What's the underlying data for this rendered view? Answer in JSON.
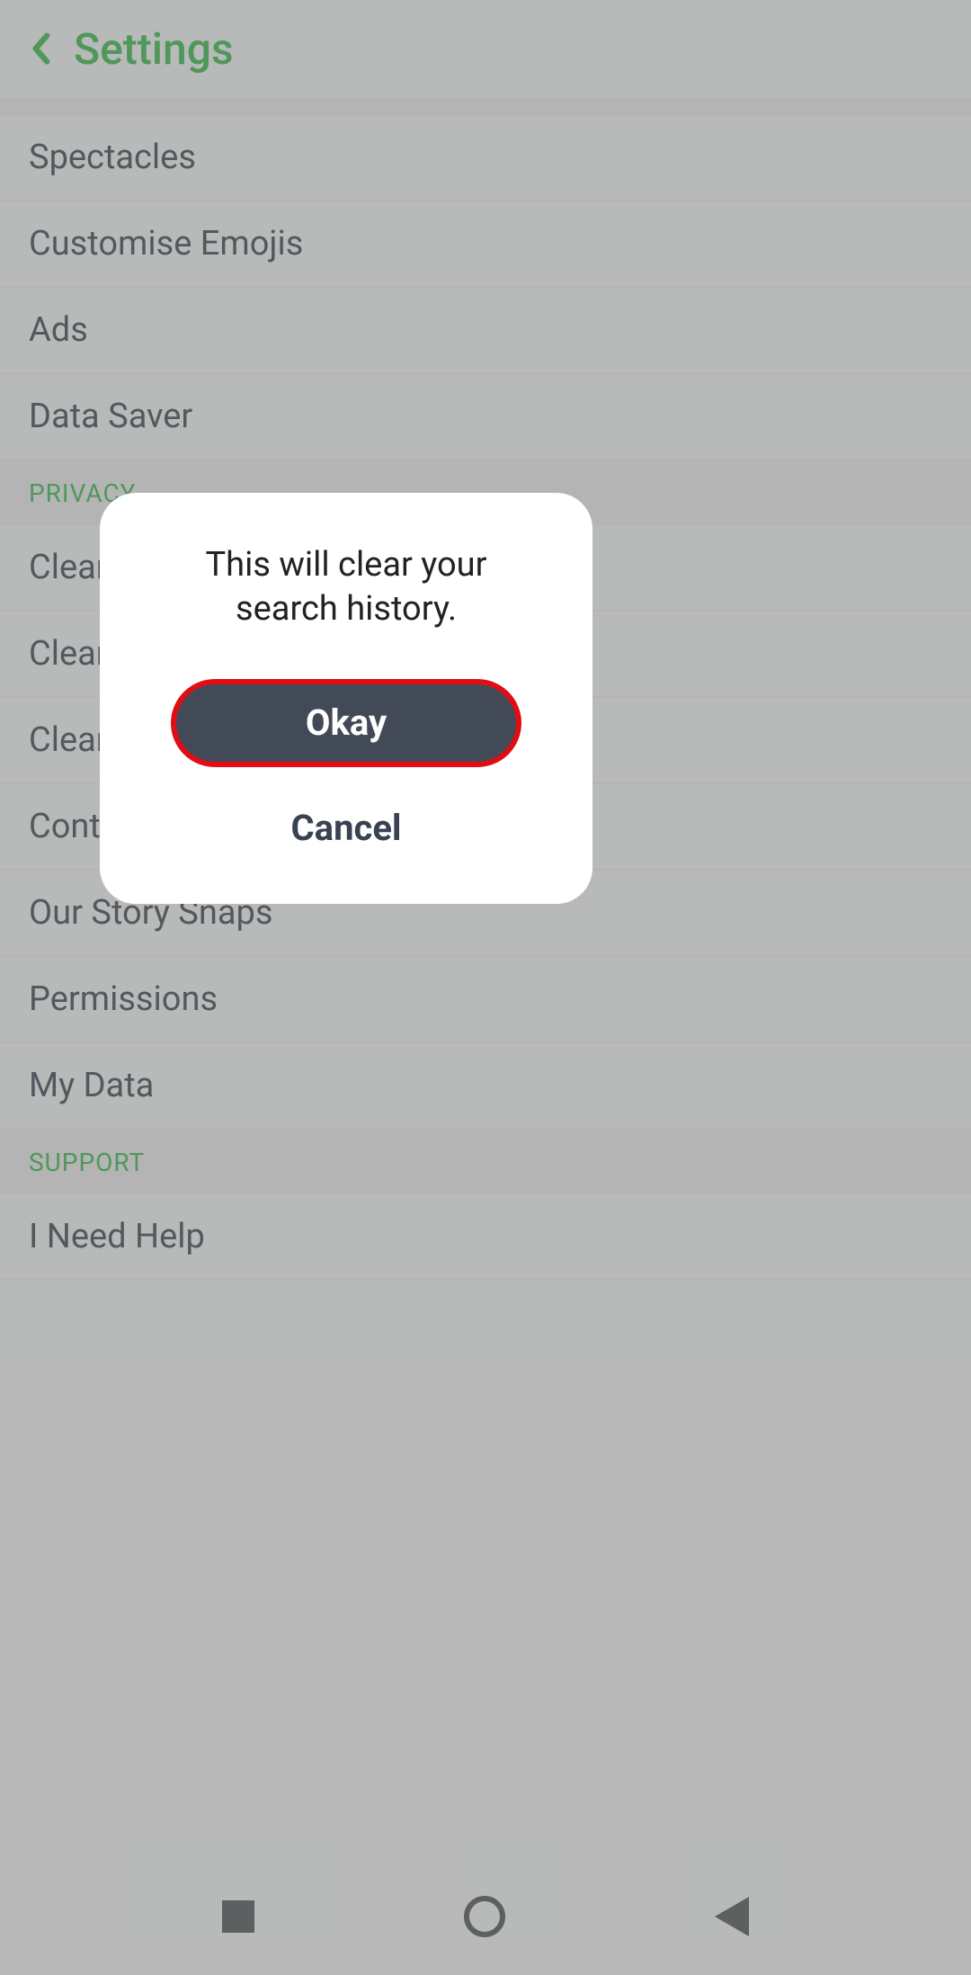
{
  "header": {
    "title": "Settings"
  },
  "sections": {
    "top_items": [
      {
        "label": "Spectacles"
      },
      {
        "label": "Customise Emojis"
      },
      {
        "label": "Ads"
      },
      {
        "label": "Data Saver"
      }
    ],
    "privacy": {
      "header": "PRIVACY",
      "items": [
        {
          "label": "Clear"
        },
        {
          "label": "Clear"
        },
        {
          "label": "Clear"
        },
        {
          "label": "Conta"
        },
        {
          "label": "Our Story Snaps"
        },
        {
          "label": "Permissions"
        },
        {
          "label": "My Data"
        }
      ]
    },
    "support": {
      "header": "SUPPORT",
      "items": [
        {
          "label": "I Need Help"
        }
      ]
    }
  },
  "modal": {
    "message": "This will clear your search history.",
    "okay_label": "Okay",
    "cancel_label": "Cancel"
  }
}
